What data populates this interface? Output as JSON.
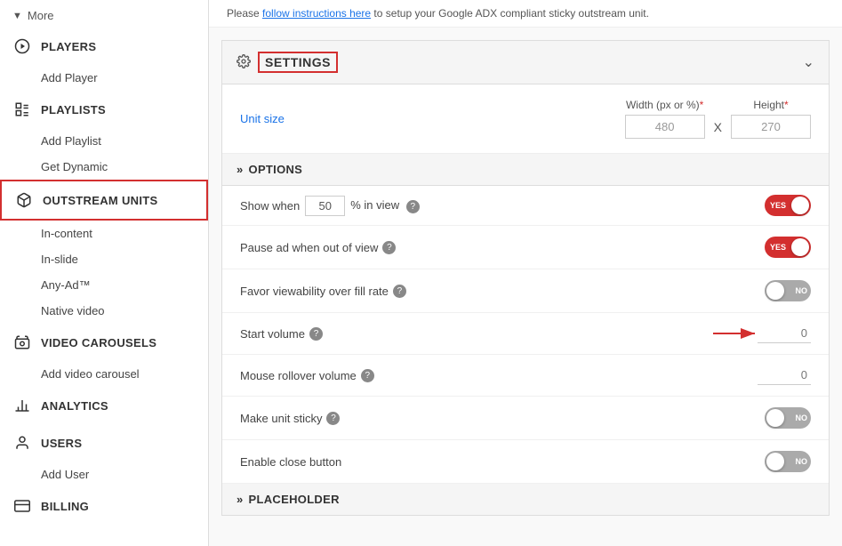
{
  "sidebar": {
    "more_label": "More",
    "sections": [
      {
        "id": "players",
        "label": "PLAYERS",
        "icon": "play-circle",
        "active": false,
        "sub_items": [
          "Add Player"
        ]
      },
      {
        "id": "playlists",
        "label": "PLAYLISTS",
        "icon": "list",
        "active": false,
        "sub_items": [
          "Add Playlist",
          "Get Dynamic"
        ]
      },
      {
        "id": "outstream",
        "label": "OUTSTREAM UNITS",
        "icon": "box",
        "active": true,
        "sub_items": [
          "In-content",
          "In-slide",
          "Any-Ad™",
          "Native video"
        ]
      },
      {
        "id": "video_carousels",
        "label": "VIDEO CAROUSELS",
        "icon": "carousel",
        "active": false,
        "sub_items": [
          "Add video carousel"
        ]
      },
      {
        "id": "analytics",
        "label": "ANALYTICS",
        "icon": "bar-chart",
        "active": false,
        "sub_items": []
      },
      {
        "id": "users",
        "label": "USERS",
        "icon": "person",
        "active": false,
        "sub_items": [
          "Add User"
        ]
      },
      {
        "id": "billing",
        "label": "BILLING",
        "icon": "credit-card",
        "active": false,
        "sub_items": []
      }
    ]
  },
  "top_notice": {
    "prefix": "Please ",
    "link_text": "follow instructions here",
    "suffix": " to setup your Google ADX compliant sticky outstream unit."
  },
  "settings": {
    "title": "SETTINGS",
    "chevron": "▾",
    "unit_size": {
      "label": "Unit size",
      "width_label": "Width (px or %)",
      "height_label": "Height",
      "required_marker": "*",
      "width_value": "480",
      "height_value": "270",
      "separator": "X"
    },
    "options": {
      "header": "OPTIONS",
      "show_when": {
        "label": "Show when",
        "value": "50",
        "suffix": "% in view"
      },
      "pause_ad": {
        "label": "Pause ad when out of view",
        "toggle_state": "on",
        "toggle_label": "YES"
      },
      "favor_viewability": {
        "label": "Favor viewability over fill rate",
        "toggle_state": "off",
        "toggle_label": "NO"
      },
      "start_volume": {
        "label": "Start volume",
        "value": "0"
      },
      "mouse_rollover": {
        "label": "Mouse rollover volume",
        "value": "0"
      },
      "make_sticky": {
        "label": "Make unit sticky",
        "toggle_state": "off",
        "toggle_label": "NO"
      },
      "enable_close": {
        "label": "Enable close button",
        "toggle_state": "off",
        "toggle_label": "NO"
      }
    },
    "placeholder": {
      "header": "PLACEHOLDER"
    }
  }
}
